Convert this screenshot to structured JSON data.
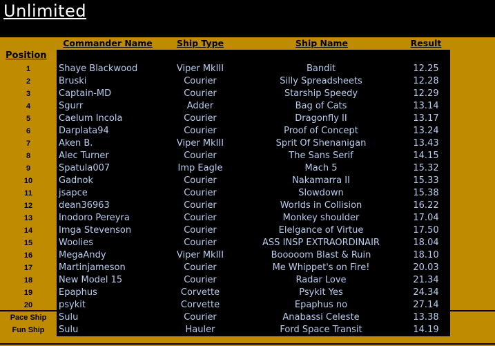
{
  "title": "Unlimited",
  "headers": {
    "position": "Position",
    "commander": "Commander Name",
    "ship_type": "Ship Type",
    "ship_name": "Ship Name",
    "result": "Result"
  },
  "colors": {
    "gold": "#bf8b00",
    "text": "#b9cdee",
    "background": "#000000"
  },
  "rows": [
    {
      "pos": "1",
      "commander": "Shaye Blackwood",
      "type": "Viper MkIII",
      "ship": "Bandit",
      "result": "12.25"
    },
    {
      "pos": "2",
      "commander": "Bruski",
      "type": "Courier",
      "ship": "Silly Spreadsheets",
      "result": "12.28"
    },
    {
      "pos": "3",
      "commander": "Captain-MD",
      "type": "Courier",
      "ship": "Starship Speedy",
      "result": "12.29"
    },
    {
      "pos": "4",
      "commander": "Sgurr",
      "type": "Adder",
      "ship": "Bag of Cats",
      "result": "13.14"
    },
    {
      "pos": "5",
      "commander": "Caelum Incola",
      "type": "Courier",
      "ship": "Dragonfly II",
      "result": "13.17"
    },
    {
      "pos": "6",
      "commander": "Darplata94",
      "type": "Courier",
      "ship": "Proof of Concept",
      "result": "13.24"
    },
    {
      "pos": "7",
      "commander": "Aken B.",
      "type": "Viper MkIII",
      "ship": "Sprit Of Shenanigan",
      "result": "13.43"
    },
    {
      "pos": "8",
      "commander": "Alec Turner",
      "type": "Courier",
      "ship": "The Sans Serif",
      "result": "14.15"
    },
    {
      "pos": "9",
      "commander": "Spatula007",
      "type": "Imp Eagle",
      "ship": "Mach 5",
      "result": "15.32"
    },
    {
      "pos": "10",
      "commander": "Gadnok",
      "type": "Courier",
      "ship": "Nakamarra II",
      "result": "15.33"
    },
    {
      "pos": "11",
      "commander": "jsapce",
      "type": "Courier",
      "ship": "Slowdown",
      "result": "15.38"
    },
    {
      "pos": "12",
      "commander": "dean36963",
      "type": "Courier",
      "ship": "Worlds in Collision",
      "result": "16.22"
    },
    {
      "pos": "13",
      "commander": "Inodoro Pereyra",
      "type": "Courier",
      "ship": "Monkey shoulder",
      "result": "17.04"
    },
    {
      "pos": "14",
      "commander": "Imga Stevenson",
      "type": "Courier",
      "ship": "Elelgance of Virtue",
      "result": "17.50"
    },
    {
      "pos": "15",
      "commander": "Woolies",
      "type": "Courier",
      "ship": "ASS INSP EXTRAORDINAIR",
      "result": "18.04"
    },
    {
      "pos": "16",
      "commander": "MegaAndy",
      "type": "Viper MkIII",
      "ship": "Booooom Blast & Ruin",
      "result": "18.10"
    },
    {
      "pos": "17",
      "commander": "Martinjameson",
      "type": "Courier",
      "ship": "Me Whippet's on Fire!",
      "result": "20.03"
    },
    {
      "pos": "18",
      "commander": "New Model 15",
      "type": "Courier",
      "ship": "Radar Love",
      "result": "21.34"
    },
    {
      "pos": "19",
      "commander": "Epaphus",
      "type": "Corvette",
      "ship": "Psykit Yes",
      "result": "24.34"
    },
    {
      "pos": "20",
      "commander": "psykit",
      "type": "Corvette",
      "ship": "Epaphus no",
      "result": "27.14"
    }
  ],
  "extra": [
    {
      "pos": "Pace Ship",
      "commander": "Sulu",
      "type": "Courier",
      "ship": "Anabassi Celeste",
      "result": "13.38"
    },
    {
      "pos": "Fun Ship",
      "commander": "Sulu",
      "type": "Hauler",
      "ship": "Ford Space Transit",
      "result": "14.19"
    }
  ]
}
